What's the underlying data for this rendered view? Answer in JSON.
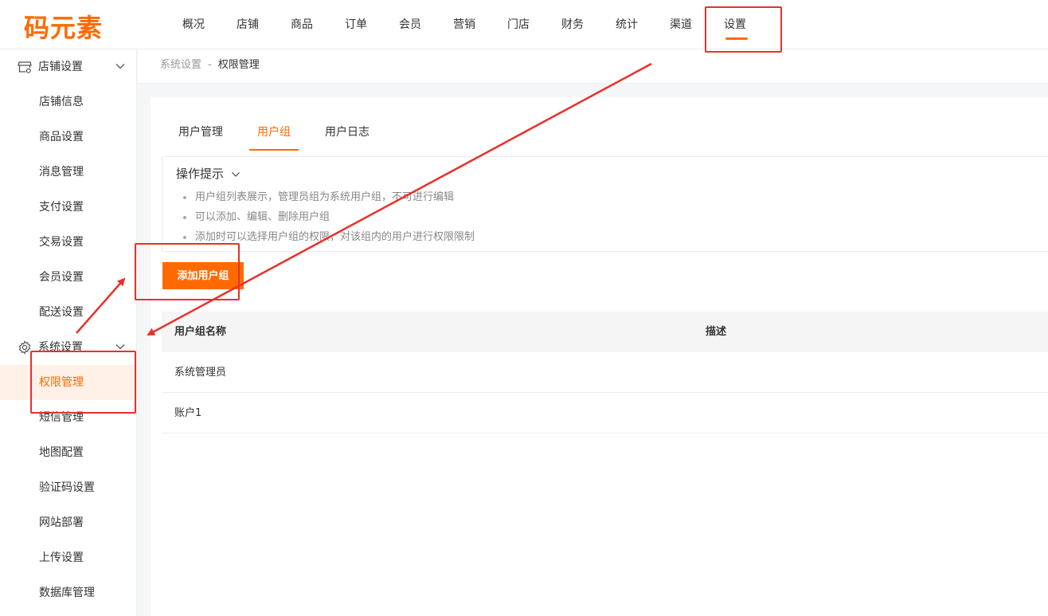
{
  "brand": {
    "logo_text": "码元素",
    "accent_color": "#ff6a00"
  },
  "top_nav": {
    "items": [
      {
        "label": "概况"
      },
      {
        "label": "店铺"
      },
      {
        "label": "商品"
      },
      {
        "label": "订单"
      },
      {
        "label": "会员"
      },
      {
        "label": "营销"
      },
      {
        "label": "门店"
      },
      {
        "label": "财务"
      },
      {
        "label": "统计"
      },
      {
        "label": "渠道"
      },
      {
        "label": "设置"
      }
    ],
    "active": "设置"
  },
  "sidebar": {
    "groups": [
      {
        "title": "店铺设置",
        "icon": "store-icon",
        "items": [
          {
            "label": "店铺信息"
          },
          {
            "label": "商品设置"
          },
          {
            "label": "消息管理"
          },
          {
            "label": "支付设置"
          },
          {
            "label": "交易设置"
          },
          {
            "label": "会员设置"
          },
          {
            "label": "配送设置"
          }
        ]
      },
      {
        "title": "系统设置",
        "icon": "gear-icon",
        "items": [
          {
            "label": "权限管理"
          },
          {
            "label": "短信管理"
          },
          {
            "label": "地图配置"
          },
          {
            "label": "验证码设置"
          },
          {
            "label": "网站部署"
          },
          {
            "label": "上传设置"
          },
          {
            "label": "数据库管理"
          }
        ]
      }
    ],
    "active_item": "权限管理"
  },
  "breadcrumb": {
    "parent": "系统设置",
    "separator": "-",
    "current": "权限管理"
  },
  "tabs": [
    {
      "label": "用户管理"
    },
    {
      "label": "用户组"
    },
    {
      "label": "用户日志"
    }
  ],
  "active_tab": "用户组",
  "tips": {
    "title": "操作提示",
    "items": [
      "用户组列表展示，管理员组为系统用户组，不可进行编辑",
      "可以添加、编辑、删除用户组",
      "添加时可以选择用户组的权限，对该组内的用户进行权限限制"
    ]
  },
  "add_button_label": "添加用户组",
  "table": {
    "headers": [
      "用户组名称",
      "描述"
    ],
    "rows": [
      [
        "系统管理员",
        ""
      ],
      [
        "账户1",
        ""
      ]
    ]
  },
  "annotation_color": "#e8312a"
}
